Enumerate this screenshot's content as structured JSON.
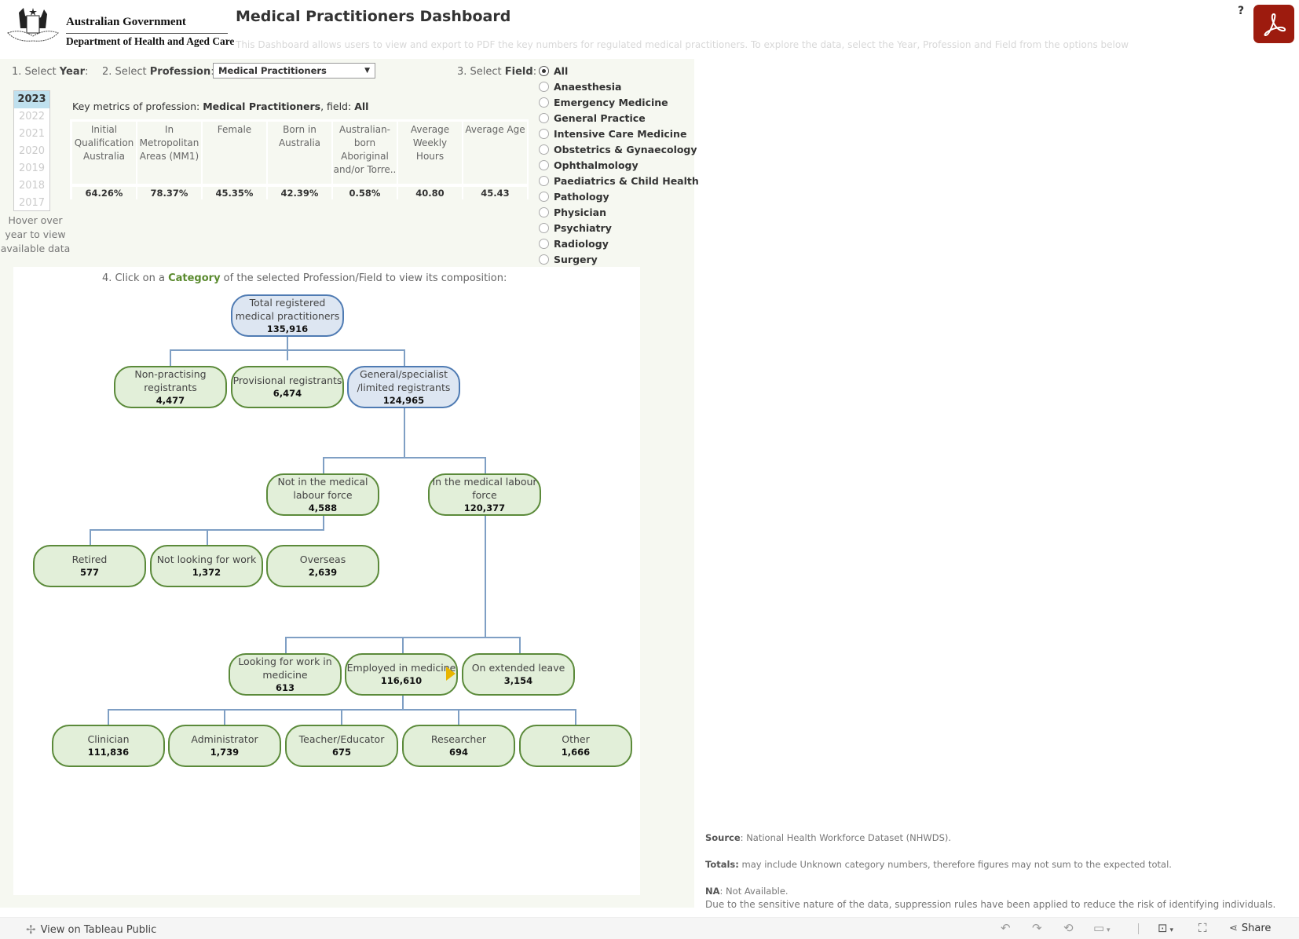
{
  "header": {
    "gov_line1": "Australian Government",
    "gov_line2": "Department of Health and Aged Care",
    "title": "Medical Practitioners Dashboard",
    "subtitle": "This Dashboard allows users to view and export to PDF the key numbers for regulated medical practitioners.  To explore the data, select the Year, Profession and Field from the options below",
    "help": "?"
  },
  "filters": {
    "year_label_prefix": "1. Select ",
    "year_label_bold": "Year",
    "profession_label_prefix": "2. Select ",
    "profession_label_bold": "Profession",
    "profession_value": "Medical Practitioners",
    "field_label_prefix": "3. Select ",
    "field_label_bold": "Field",
    "colon": ":",
    "years": [
      "2023",
      "2022",
      "2021",
      "2020",
      "2019",
      "2018",
      "2017"
    ],
    "selected_year": "2023",
    "hover_note": "Hover over year to view available data",
    "fields": [
      "All",
      "Anaesthesia",
      "Emergency Medicine",
      "General Practice",
      "Intensive Care Medicine",
      "Obstetrics & Gynaecology",
      "Ophthalmology",
      "Paediatrics & Child Health",
      "Pathology",
      "Physician",
      "Psychiatry",
      "Radiology",
      "Surgery"
    ],
    "selected_field": "All"
  },
  "key_metrics": {
    "title_prefix": "Key metrics of profession: ",
    "profession": "Medical Practitioners",
    "field_prefix": ", field: ",
    "field": "All",
    "columns": [
      {
        "label": "Initial Qualification Australia",
        "value": "64.26%"
      },
      {
        "label": "In Metropolitan Areas (MM1)",
        "value": "78.37%"
      },
      {
        "label": "Female",
        "value": "45.35%"
      },
      {
        "label": "Born in Australia",
        "value": "42.39%"
      },
      {
        "label": "Australian-born Aboriginal and/or Torre..",
        "value": "0.58%"
      },
      {
        "label": "Average Weekly Hours",
        "value": "40.80"
      },
      {
        "label": "Average Age",
        "value": "45.43"
      }
    ]
  },
  "tree": {
    "instruction_prefix": "4. Click on a ",
    "instruction_bold": "Category",
    "instruction_suffix": " of the selected Profession/Field to view its composition:",
    "nodes": {
      "total": {
        "label": "Total registered medical practitioners",
        "value": "135,916"
      },
      "non_practising": {
        "label": "Non-practising registrants",
        "value": "4,477"
      },
      "provisional": {
        "label": "Provisional registrants",
        "value": "6,474"
      },
      "general": {
        "label": "General/specialist /limited registrants",
        "value": "124,965"
      },
      "not_in_lf": {
        "label": "Not in the medical labour force",
        "value": "4,588"
      },
      "in_lf": {
        "label": "In the medical labour force",
        "value": "120,377"
      },
      "retired": {
        "label": "Retired",
        "value": "577"
      },
      "not_looking": {
        "label": "Not looking for work",
        "value": "1,372"
      },
      "overseas": {
        "label": "Overseas",
        "value": "2,639"
      },
      "looking": {
        "label": "Looking for work in medicine",
        "value": "613"
      },
      "employed": {
        "label": "Employed in medicine",
        "value": "116,610"
      },
      "extended_leave": {
        "label": "On extended leave",
        "value": "3,154"
      },
      "clinician": {
        "label": "Clinician",
        "value": "111,836"
      },
      "administrator": {
        "label": "Administrator",
        "value": "1,739"
      },
      "teacher": {
        "label": "Teacher/Educator",
        "value": "675"
      },
      "researcher": {
        "label": "Researcher",
        "value": "694"
      },
      "other": {
        "label": "Other",
        "value": "1,666"
      }
    }
  },
  "notes": {
    "source_label": "Source",
    "source_text": ": National Health Workforce Dataset (NHWDS).",
    "totals_label": "Totals:",
    "totals_text": " may include Unknown category numbers, therefore figures may not sum to the expected total.",
    "na_label": "NA",
    "na_text": ": Not Available.",
    "suppression": "Due to the sensitive nature of the data, suppression rules have been applied to reduce the risk of identifying individuals."
  },
  "footer": {
    "view_on": "View on Tableau Public",
    "share": "Share"
  }
}
